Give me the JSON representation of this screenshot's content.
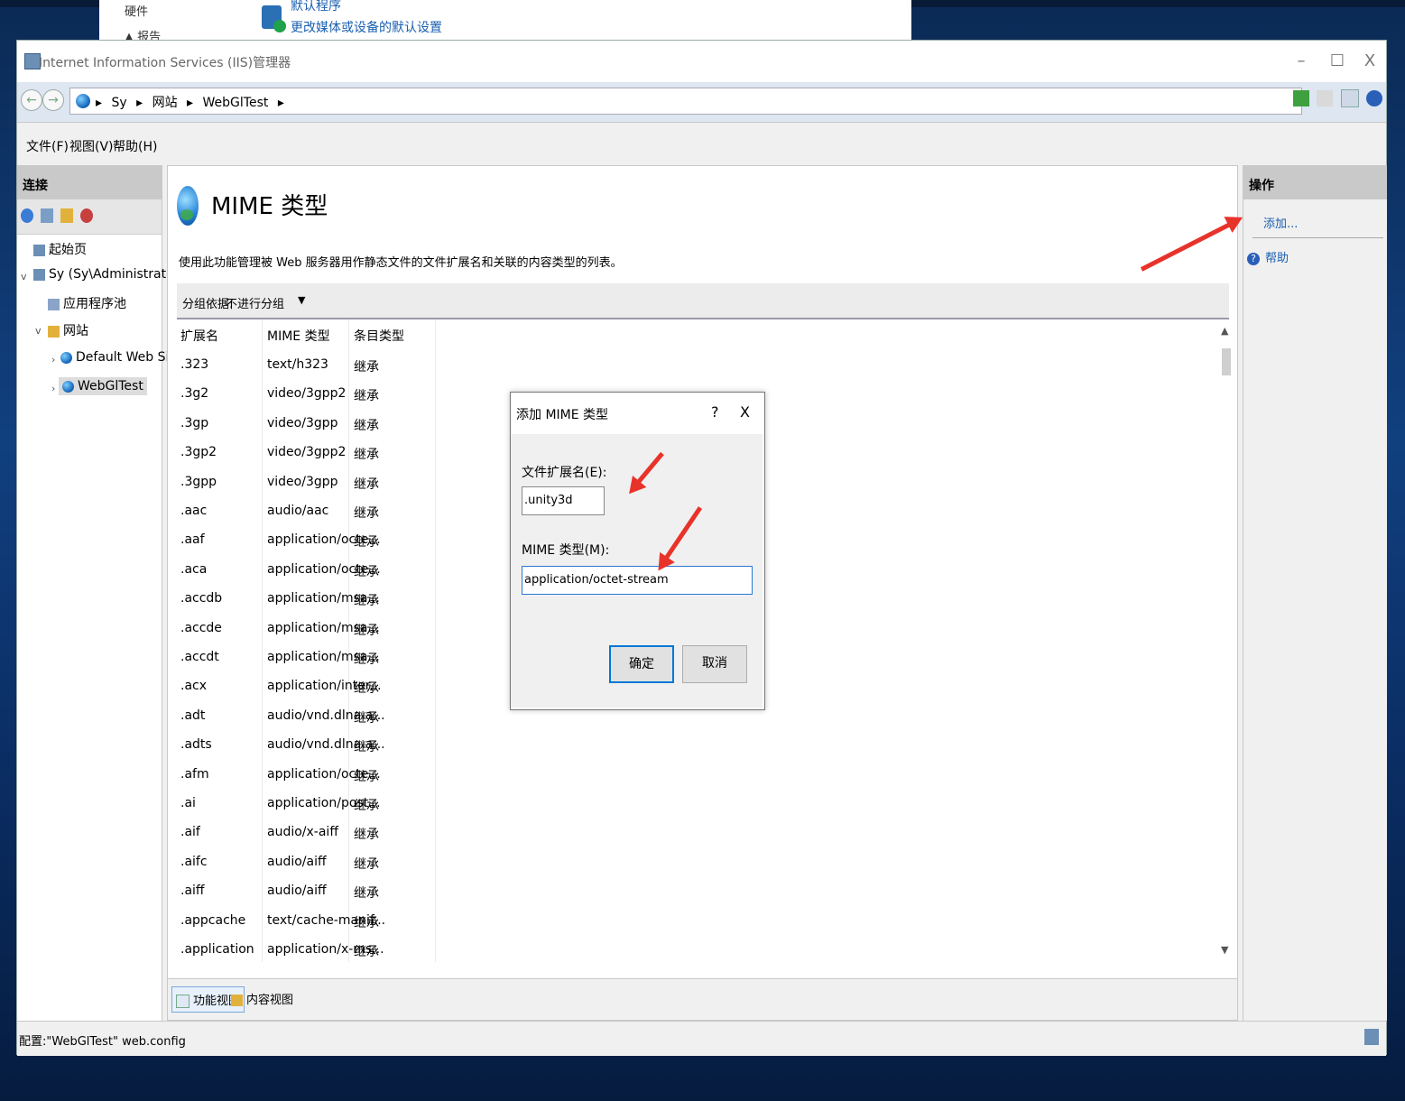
{
  "background_window": {
    "line1": "硬件",
    "line2": "▲ 报告",
    "line3": "默认程序",
    "line4": "更改媒体或设备的默认设置"
  },
  "window": {
    "title": "Internet Information Services (IIS)管理器",
    "controls": {
      "minimize": "–",
      "maximize": "☐",
      "close": "X"
    }
  },
  "address": {
    "back": "←",
    "forward": "→",
    "crumbs": [
      "Sy",
      "网站",
      "WebGlTest"
    ],
    "separator": "▸"
  },
  "menu": {
    "file": "文件(F)",
    "view": "视图(V)",
    "help": "帮助(H)"
  },
  "connections": {
    "header": "连接",
    "tree": {
      "start": "起始页",
      "server": "Sy (Sy\\Administrator)",
      "app_pools": "应用程序池",
      "sites": "网站",
      "default_site": "Default Web Site",
      "webgl": "WebGlTest"
    }
  },
  "feature": {
    "title": "MIME 类型",
    "description": "使用此功能管理被 Web 服务器用作静态文件的文件扩展名和关联的内容类型的列表。",
    "group_label": "分组依据:",
    "group_value": "不进行分组",
    "columns": {
      "ext": "扩展名",
      "mime": "MIME 类型",
      "type": "条目类型"
    },
    "rows": [
      [
        ".323",
        "text/h323",
        "继承"
      ],
      [
        ".3g2",
        "video/3gpp2",
        "继承"
      ],
      [
        ".3gp",
        "video/3gpp",
        "继承"
      ],
      [
        ".3gp2",
        "video/3gpp2",
        "继承"
      ],
      [
        ".3gpp",
        "video/3gpp",
        "继承"
      ],
      [
        ".aac",
        "audio/aac",
        "继承"
      ],
      [
        ".aaf",
        "application/octe...",
        "继承"
      ],
      [
        ".aca",
        "application/octe...",
        "继承"
      ],
      [
        ".accdb",
        "application/msa...",
        "继承"
      ],
      [
        ".accde",
        "application/msa...",
        "继承"
      ],
      [
        ".accdt",
        "application/msa...",
        "继承"
      ],
      [
        ".acx",
        "application/inter...",
        "继承"
      ],
      [
        ".adt",
        "audio/vnd.dlna.a...",
        "继承"
      ],
      [
        ".adts",
        "audio/vnd.dlna.a...",
        "继承"
      ],
      [
        ".afm",
        "application/octe...",
        "继承"
      ],
      [
        ".ai",
        "application/post...",
        "继承"
      ],
      [
        ".aif",
        "audio/x-aiff",
        "继承"
      ],
      [
        ".aifc",
        "audio/aiff",
        "继承"
      ],
      [
        ".aiff",
        "audio/aiff",
        "继承"
      ],
      [
        ".appcache",
        "text/cache-manif...",
        "继承"
      ],
      [
        ".application",
        "application/x-ms...",
        "继承"
      ]
    ]
  },
  "view_tabs": {
    "features": "功能视图",
    "content": "内容视图"
  },
  "actions": {
    "header": "操作",
    "add": "添加...",
    "help": "帮助"
  },
  "status": {
    "text": "配置:\"WebGlTest\" web.config"
  },
  "dialog": {
    "title": "添加 MIME 类型",
    "help": "?",
    "close": "X",
    "ext_label": "文件扩展名(E):",
    "ext_value": ".unity3d",
    "mime_label": "MIME 类型(M):",
    "mime_value": "application/octet-stream",
    "ok": "确定",
    "cancel": "取消"
  },
  "colors": {
    "accent": "#0078d7",
    "link": "#1a5fb0",
    "annotation_arrow": "#e8332a"
  }
}
